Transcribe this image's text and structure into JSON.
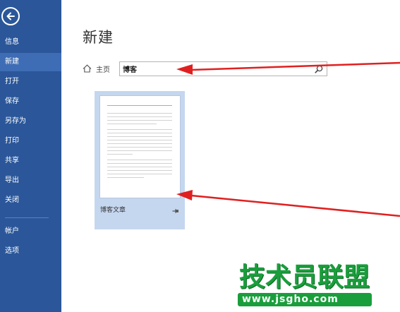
{
  "sidebar": {
    "back_icon": "back-arrow-icon",
    "items": [
      {
        "label": "信息",
        "active": false
      },
      {
        "label": "新建",
        "active": true
      },
      {
        "label": "打开",
        "active": false
      },
      {
        "label": "保存",
        "active": false
      },
      {
        "label": "另存为",
        "active": false
      },
      {
        "label": "打印",
        "active": false
      },
      {
        "label": "共享",
        "active": false
      },
      {
        "label": "导出",
        "active": false
      },
      {
        "label": "关闭",
        "active": false
      },
      {
        "label": "帐户",
        "active": false
      },
      {
        "label": "选项",
        "active": false
      }
    ]
  },
  "main": {
    "title": "新建",
    "breadcrumb": {
      "home_icon": "home-icon",
      "label": "主页"
    },
    "search": {
      "value": "博客",
      "icon": "search-icon"
    },
    "templates": [
      {
        "name": "博客文章",
        "pin_icon": "pin-icon"
      }
    ]
  },
  "watermark": {
    "title": "技术员联盟",
    "url": "www.jsgho.com"
  },
  "colors": {
    "sidebar_bg": "#2b579a",
    "sidebar_active": "#3e6db5",
    "card_bg": "#c5d6ef",
    "annotation_arrow": "#e02020",
    "watermark_green": "#1a9e3c"
  }
}
